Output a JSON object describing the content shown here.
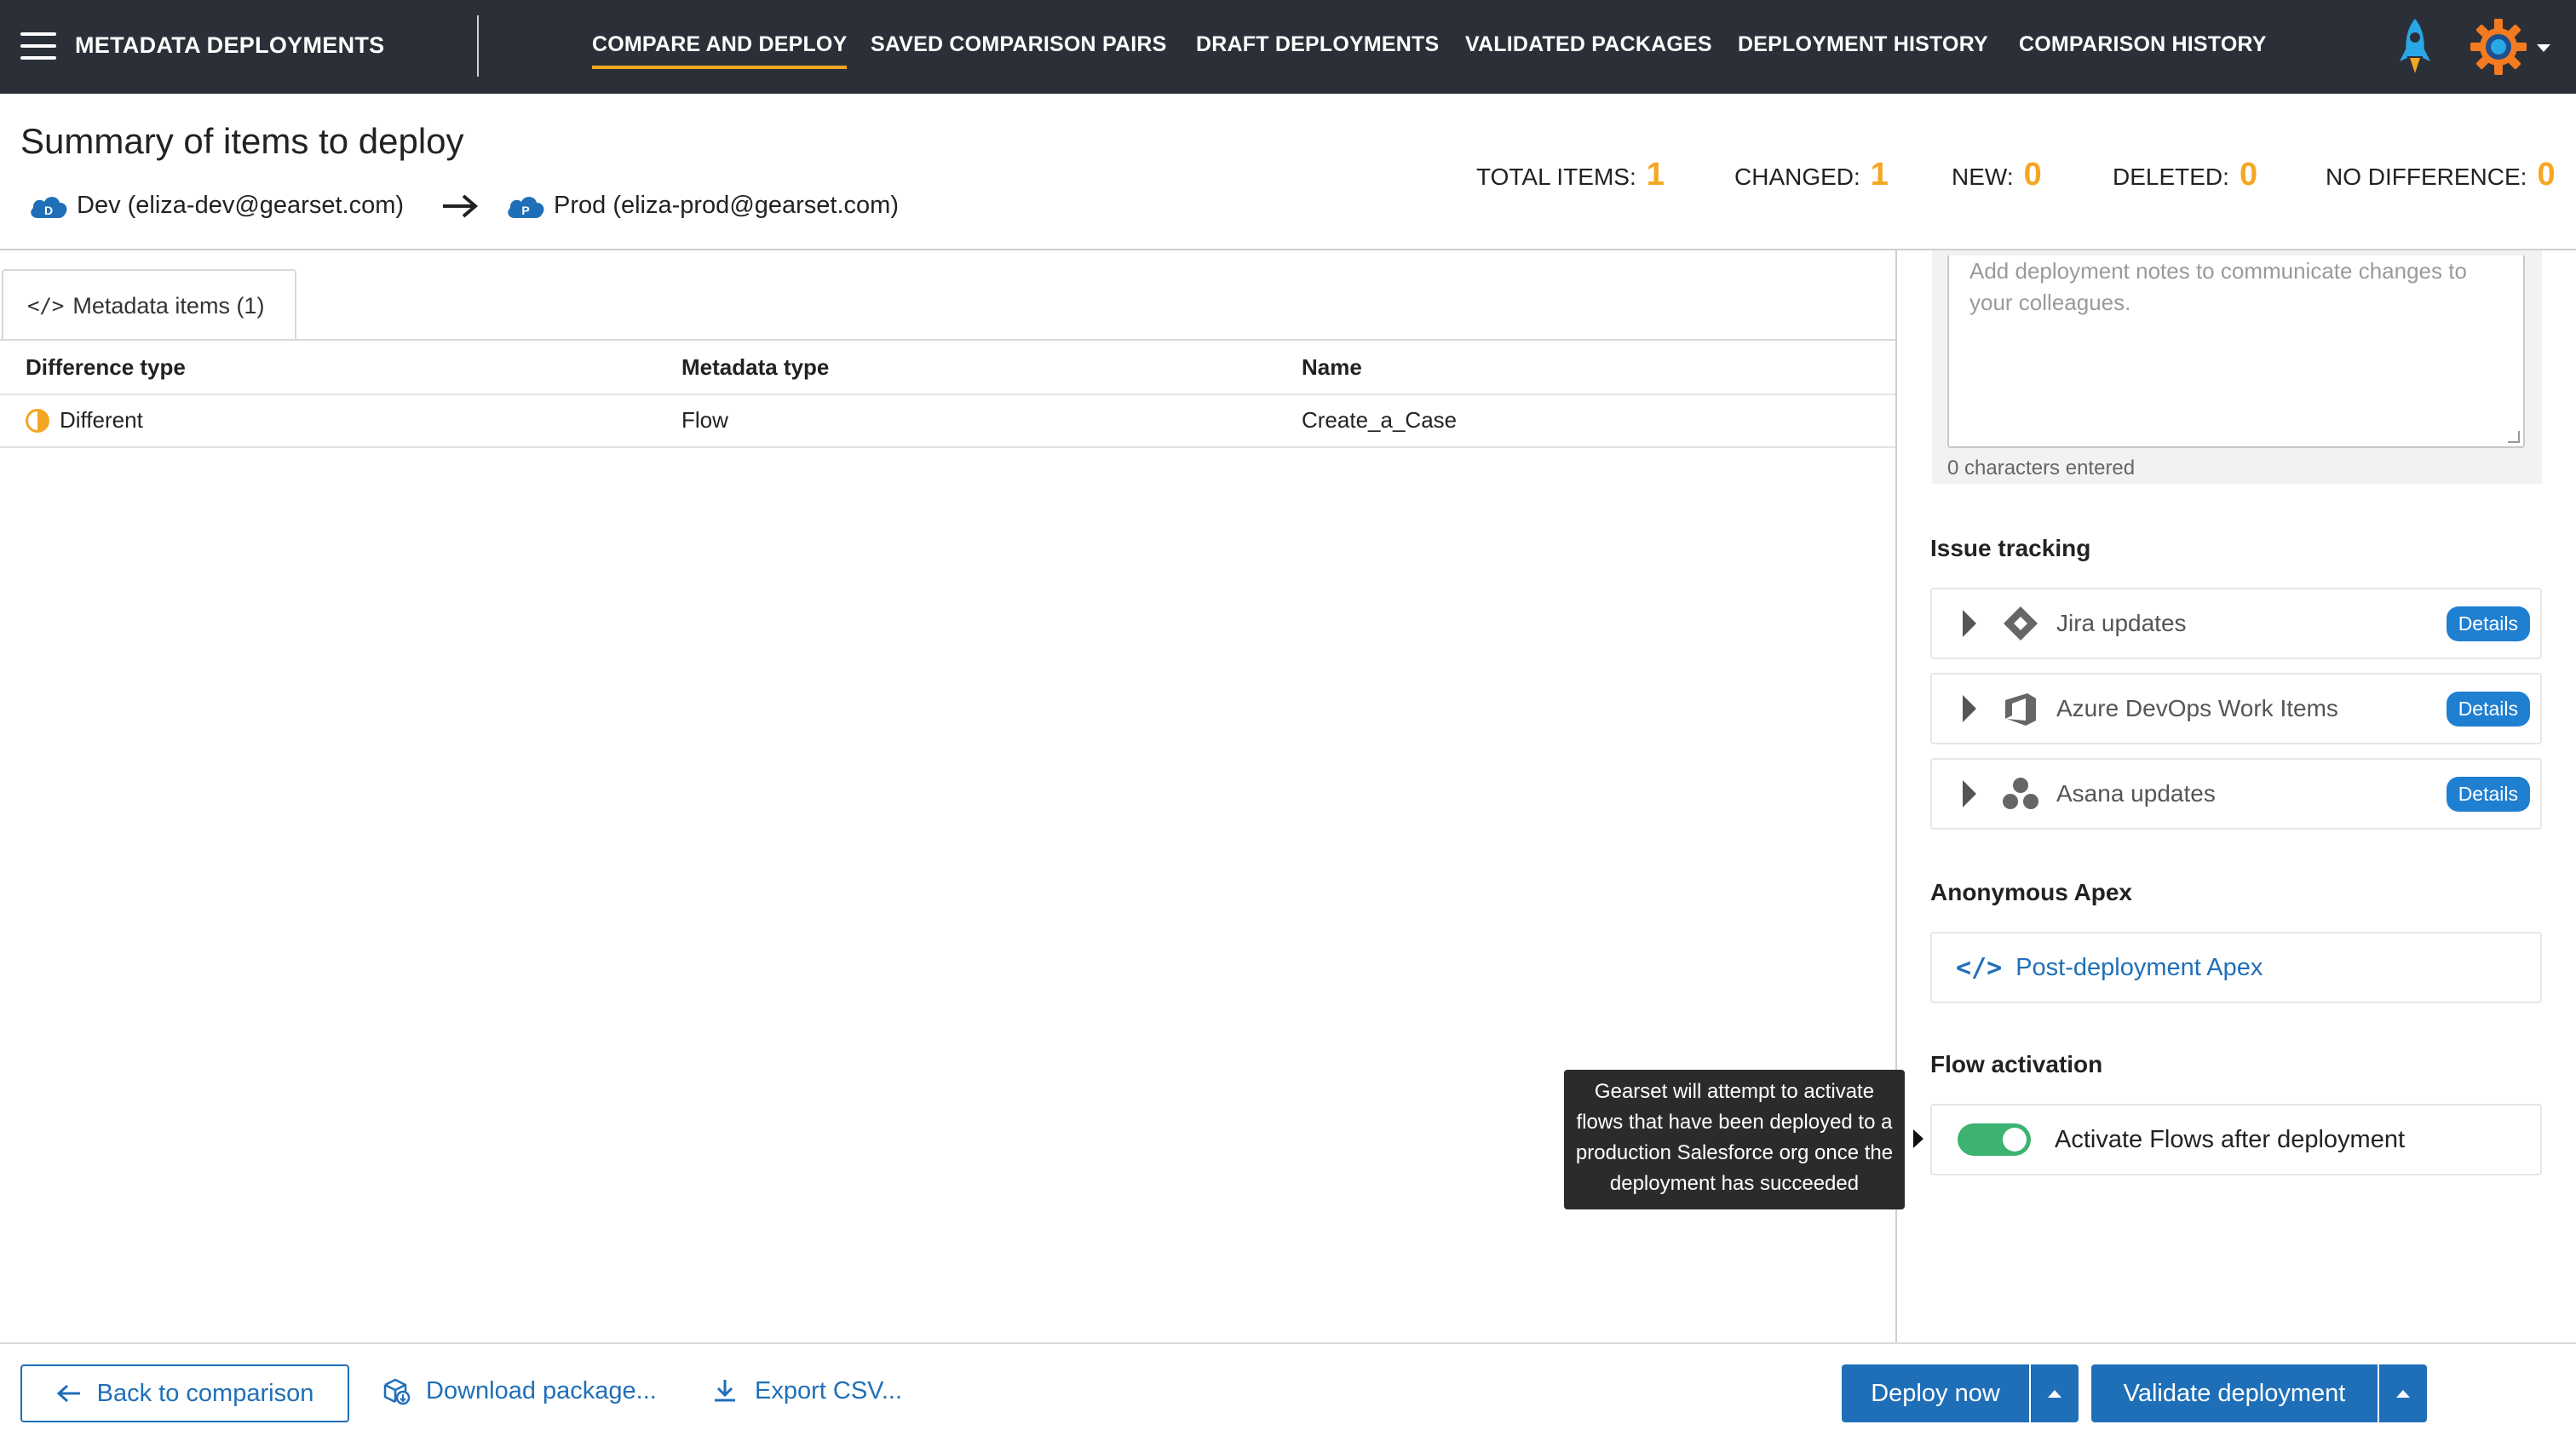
{
  "nav": {
    "app_title": "METADATA DEPLOYMENTS",
    "items": [
      {
        "label": "COMPARE AND DEPLOY",
        "active": true
      },
      {
        "label": "SAVED COMPARISON PAIRS",
        "active": false
      },
      {
        "label": "DRAFT DEPLOYMENTS",
        "active": false
      },
      {
        "label": "VALIDATED PACKAGES",
        "active": false
      },
      {
        "label": "DEPLOYMENT HISTORY",
        "active": false
      },
      {
        "label": "COMPARISON HISTORY",
        "active": false
      }
    ],
    "icons": [
      "hamburger-menu-icon",
      "rocket-icon",
      "gear-settings-icon",
      "chevron-down-icon"
    ],
    "accent_color": "#f5a623",
    "bar_color": "#2b3038"
  },
  "summary": {
    "title": "Summary of items to deploy",
    "source": {
      "badge": "D",
      "label": "Dev (eliza-dev@gearset.com)"
    },
    "target": {
      "badge": "P",
      "label": "Prod (eliza-prod@gearset.com)"
    },
    "stats": [
      {
        "label": "TOTAL ITEMS:",
        "value": "1"
      },
      {
        "label": "CHANGED:",
        "value": "1"
      },
      {
        "label": "NEW:",
        "value": "0"
      },
      {
        "label": "DELETED:",
        "value": "0"
      },
      {
        "label": "NO DIFFERENCE:",
        "value": "0"
      }
    ]
  },
  "metadata": {
    "tab_label": "Metadata items (1)",
    "columns": [
      "Difference type",
      "Metadata type",
      "Name"
    ],
    "rows": [
      {
        "difference": "Different",
        "type": "Flow",
        "name": "Create_a_Case"
      }
    ]
  },
  "notes": {
    "placeholder": "Add deployment notes to communicate changes to your colleagues.",
    "char_count": "0 characters entered"
  },
  "issue_tracking": {
    "heading": "Issue tracking",
    "items": [
      {
        "label": "Jira updates",
        "badge": "Details",
        "icon": "jira-icon"
      },
      {
        "label": "Azure DevOps Work Items",
        "badge": "Details",
        "icon": "azure-devops-icon"
      },
      {
        "label": "Asana updates",
        "badge": "Details",
        "icon": "asana-icon"
      }
    ]
  },
  "anonymous_apex": {
    "heading": "Anonymous Apex",
    "link": "Post-deployment Apex"
  },
  "flow_activation": {
    "heading": "Flow activation",
    "toggle_label": "Activate Flows after deployment",
    "enabled": true,
    "tooltip": "Gearset will attempt to activate flows that have been deployed to a production Salesforce org once the deployment has succeeded"
  },
  "footer": {
    "back_label": "Back to comparison",
    "download_label": "Download package...",
    "export_label": "Export CSV...",
    "deploy_label": "Deploy now",
    "validate_label": "Validate deployment",
    "primary_color": "#1f6fb8"
  }
}
